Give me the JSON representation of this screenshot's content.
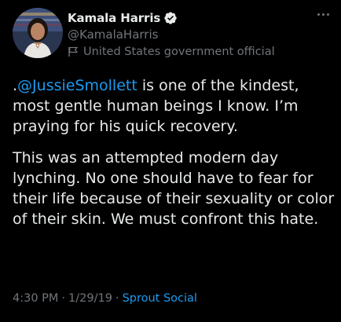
{
  "author": {
    "display_name": "Kamala Harris",
    "handle": "@KamalaHarris",
    "label": "United States government official",
    "verified_icon": "verified-badge-icon",
    "label_icon": "flag-icon"
  },
  "tweet": {
    "mention": "@JussieSmollett",
    "para1_prefix": ".",
    "para1_rest": " is one of the kindest, most gentle human beings I know. I’m praying for his quick recovery.",
    "para2": "This was an attempted modern day lynching. No one should have to fear for their life because of their sexuality or color of their skin. We must confront this hate."
  },
  "meta": {
    "time": "4:30 PM",
    "separator": "·",
    "date": "1/29/19",
    "source": "Sprout Social"
  },
  "colors": {
    "background": "#000000",
    "text": "#e7e9ea",
    "secondary": "#71767b",
    "accent": "#1d9bf0"
  }
}
